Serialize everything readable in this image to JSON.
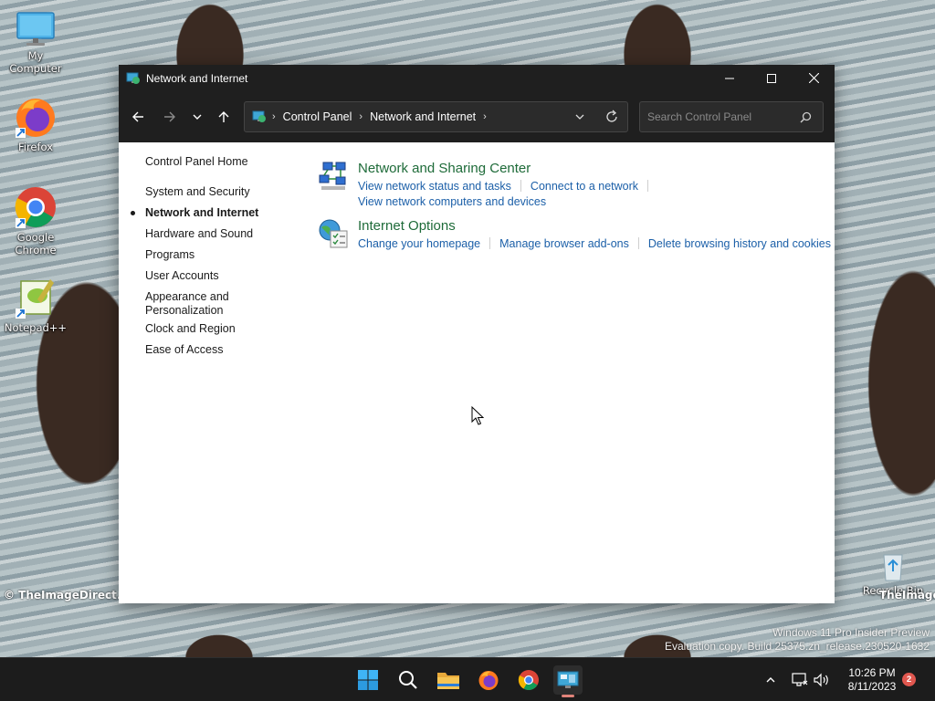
{
  "desktop": {
    "icons": [
      {
        "label": "My Computer",
        "icon": "monitor-icon"
      },
      {
        "label": "Firefox",
        "icon": "firefox-icon"
      },
      {
        "label": "Google Chrome",
        "icon": "chrome-icon"
      },
      {
        "label": "Notepad++",
        "icon": "notepadpp-icon"
      },
      {
        "label": "Recycle Bin",
        "icon": "recycle-bin-icon"
      }
    ],
    "watermark_left": "© TheImageDirect.com",
    "watermark_right": "TheImageDi",
    "eval_line1": "Windows 11 Pro Insider Preview",
    "eval_line2": "Evaluation copy. Build 25375.zn_release.230520-1632"
  },
  "window": {
    "title": "Network and Internet",
    "breadcrumbs": [
      "Control Panel",
      "Network and Internet"
    ],
    "search_placeholder": "Search Control Panel"
  },
  "sidebar": {
    "items": [
      {
        "label": "Control Panel Home"
      },
      {
        "label": "System and Security"
      },
      {
        "label": "Network and Internet",
        "current": true
      },
      {
        "label": "Hardware and Sound"
      },
      {
        "label": "Programs"
      },
      {
        "label": "User Accounts"
      },
      {
        "label": "Appearance and Personalization",
        "line1": "Appearance and",
        "line2": "Personalization"
      },
      {
        "label": "Clock and Region"
      },
      {
        "label": "Ease of Access"
      }
    ]
  },
  "categories": [
    {
      "title": "Network and Sharing Center",
      "links_row1": [
        "View network status and tasks",
        "Connect to a network"
      ],
      "links_row2": [
        "View network computers and devices"
      ]
    },
    {
      "title": "Internet Options",
      "links_row1": [
        "Change your homepage",
        "Manage browser add-ons",
        "Delete browsing history and cookies"
      ]
    }
  ],
  "taskbar": {
    "time": "10:26 PM",
    "date": "8/11/2023",
    "notification_count": "2"
  },
  "colors": {
    "accent_green": "#1e6b39",
    "link_blue": "#1b5fa8",
    "titlebar": "#1f1f1f"
  }
}
